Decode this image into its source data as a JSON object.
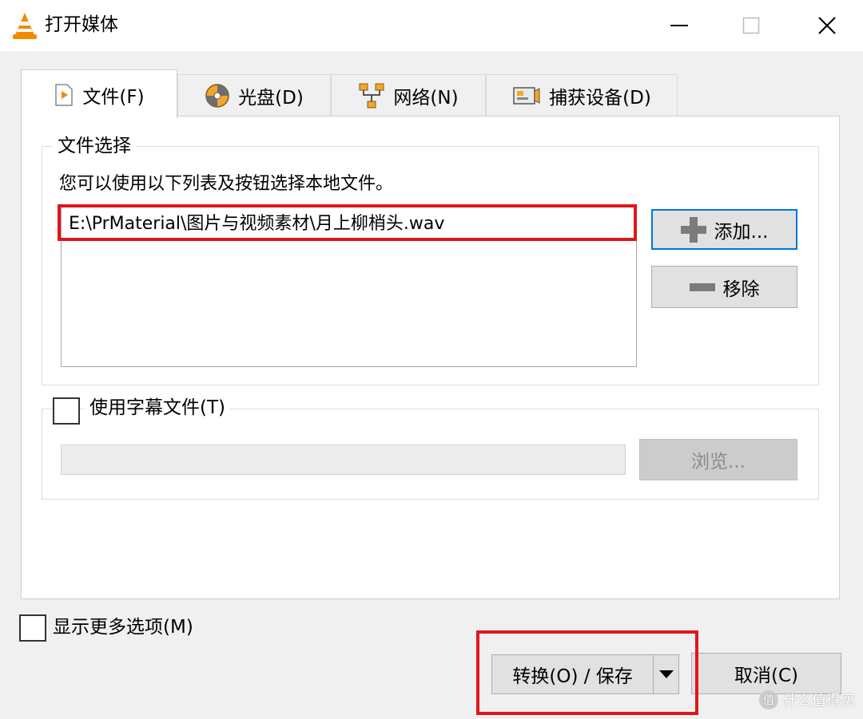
{
  "window": {
    "title": "打开媒体",
    "logo_icon": "vlc-cone-icon",
    "controls": [
      "minimize-icon",
      "maximize-icon",
      "close-icon"
    ]
  },
  "tabs": [
    {
      "label": "文件(F)",
      "icon": "file-play-icon",
      "active": true
    },
    {
      "label": "光盘(D)",
      "icon": "disc-icon",
      "active": false
    },
    {
      "label": "网络(N)",
      "icon": "network-icon",
      "active": false
    },
    {
      "label": "捕获设备(D)",
      "icon": "capture-device-icon",
      "active": false
    }
  ],
  "file_selection": {
    "legend": "文件选择",
    "hint": "您可以使用以下列表及按钮选择本地文件。",
    "files": [
      "E:\\PrMaterial\\图片与视频素材\\月上柳梢头.wav"
    ],
    "add_label": "添加...",
    "remove_label": "移除"
  },
  "subtitle": {
    "label": "使用字幕文件(T)",
    "checked": false,
    "path": "",
    "browse_label": "浏览..."
  },
  "footer": {
    "more_options_label": "显示更多选项(M)",
    "more_options_checked": false,
    "convert_label": "转换(O) / 保存",
    "cancel_label": "取消(C)"
  },
  "watermark": {
    "badge": "值",
    "text": "什么值得买"
  },
  "colors": {
    "highlight": "#e0161b",
    "focus_border": "#0078d7",
    "vlc_orange": "#f08a00"
  }
}
